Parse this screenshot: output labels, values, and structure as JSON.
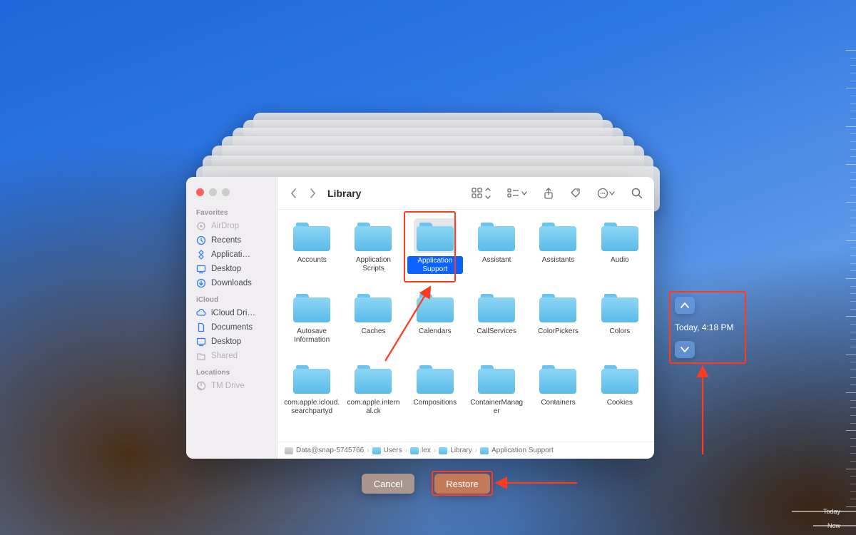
{
  "window_title": "Library",
  "sidebar": {
    "sections": [
      {
        "title": "Favorites",
        "items": [
          {
            "label": "AirDrop",
            "icon": "airdrop-icon",
            "dim": true
          },
          {
            "label": "Recents",
            "icon": "clock-icon",
            "dim": false
          },
          {
            "label": "Applicati…",
            "icon": "apps-icon",
            "dim": false
          },
          {
            "label": "Desktop",
            "icon": "desktop-icon",
            "dim": false
          },
          {
            "label": "Downloads",
            "icon": "downloads-icon",
            "dim": false
          }
        ]
      },
      {
        "title": "iCloud",
        "items": [
          {
            "label": "iCloud Dri…",
            "icon": "cloud-icon",
            "dim": false
          },
          {
            "label": "Documents",
            "icon": "document-icon",
            "dim": false
          },
          {
            "label": "Desktop",
            "icon": "desktop-icon",
            "dim": false
          },
          {
            "label": "Shared",
            "icon": "shared-icon",
            "dim": true
          }
        ]
      },
      {
        "title": "Locations",
        "items": [
          {
            "label": "TM Drive",
            "icon": "timemachine-icon",
            "dim": true
          }
        ]
      }
    ]
  },
  "folders": [
    {
      "label": "Accounts"
    },
    {
      "label": "Application Scripts"
    },
    {
      "label": "Application Support",
      "selected": true
    },
    {
      "label": "Assistant"
    },
    {
      "label": "Assistants"
    },
    {
      "label": "Audio"
    },
    {
      "label": "Autosave Information"
    },
    {
      "label": "Caches"
    },
    {
      "label": "Calendars"
    },
    {
      "label": "CallServices"
    },
    {
      "label": "ColorPickers"
    },
    {
      "label": "Colors"
    },
    {
      "label": "com.apple.icloud.searchpartyd"
    },
    {
      "label": "com.apple.internal.ck"
    },
    {
      "label": "Compositions"
    },
    {
      "label": "ContainerManager"
    },
    {
      "label": "Containers"
    },
    {
      "label": "Cookies"
    }
  ],
  "pathbar": [
    {
      "label": "Data@snap-5745766",
      "kind": "disk"
    },
    {
      "label": "Users",
      "kind": "folder"
    },
    {
      "label": "lex",
      "kind": "folder"
    },
    {
      "label": "Library",
      "kind": "folder"
    },
    {
      "label": "Application Support",
      "kind": "folder"
    }
  ],
  "buttons": {
    "cancel": "Cancel",
    "restore": "Restore"
  },
  "timeline": {
    "label": "Today, 4:18 PM",
    "ticks_bottom": [
      "Today",
      "Now"
    ]
  }
}
